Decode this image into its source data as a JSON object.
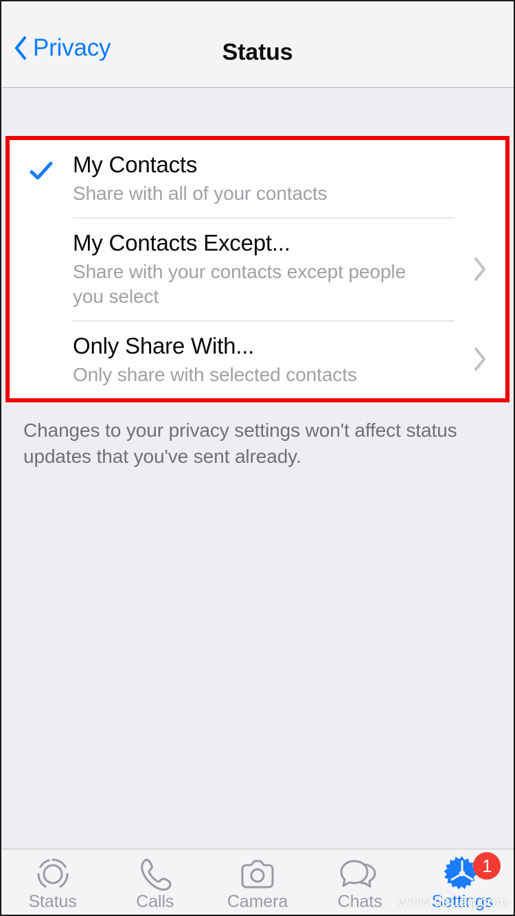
{
  "header": {
    "back_label": "Privacy",
    "back_icon": "chevron-left-icon",
    "title": "Status"
  },
  "list": {
    "options": [
      {
        "title": "My Contacts",
        "subtitle": "Share with all of your contacts",
        "selected": true,
        "accessory": "checkmark-icon"
      },
      {
        "title": "My Contacts Except...",
        "subtitle": "Share with your contacts except people you select",
        "selected": false,
        "accessory": "chevron-right-icon"
      },
      {
        "title": "Only Share With...",
        "subtitle": "Only share with selected contacts",
        "selected": false,
        "accessory": "chevron-right-icon"
      }
    ],
    "footer_note": "Changes to your privacy settings won't affect status updates that you've sent already."
  },
  "tabbar": {
    "items": [
      {
        "label": "Status",
        "icon": "status-ring-icon",
        "active": false
      },
      {
        "label": "Calls",
        "icon": "phone-icon",
        "active": false
      },
      {
        "label": "Camera",
        "icon": "camera-icon",
        "active": false
      },
      {
        "label": "Chats",
        "icon": "chat-bubbles-icon",
        "active": false
      },
      {
        "label": "Settings",
        "icon": "gear-icon",
        "active": true,
        "badge": "1"
      }
    ]
  },
  "watermark": "www.deuaq.com",
  "colors": {
    "accent_blue": "#0a7cff",
    "active_blue": "#1a7bfb",
    "highlight_red": "#ee0000",
    "badge_red": "#f23b32",
    "subtitle_gray": "#a0a0a6",
    "page_background": "#eeeef2",
    "card_background": "#ffffff"
  }
}
